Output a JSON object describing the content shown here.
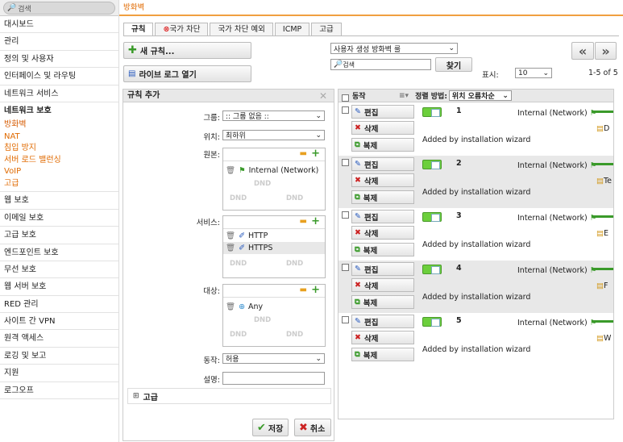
{
  "sidebar": {
    "search_placeholder": "검색",
    "items": [
      "대시보드",
      "관리",
      "정의 및 사용자",
      "인터페이스 및 라우팅",
      "네트워크 서비스"
    ],
    "section": "네트워크 보호",
    "subs": [
      "방화벽",
      "NAT",
      "침입 방지",
      "서버 로드 밸런싱",
      "VoIP",
      "고급"
    ],
    "items2": [
      "웹 보호",
      "이메일 보호",
      "고급 보호",
      "엔드포인트 보호",
      "무선 보호",
      "웹 서버 보호",
      "RED 관리",
      "사이트 간 VPN",
      "원격 액세스",
      "로깅 및 보고",
      "지원",
      "로그오프"
    ]
  },
  "page": {
    "title": "방화벽"
  },
  "tabs": [
    "규칙",
    "국가 차단",
    "국가 차단 예외",
    "ICMP",
    "고급"
  ],
  "toolbar": {
    "new_rule": "새 규칙...",
    "live_log": "라이브 로그 열기",
    "filter_select": "사용자 생성 방화벽 룰",
    "search_placeholder": "검색",
    "find": "찾기",
    "display_label": "표시:",
    "display_value": "10",
    "range": "1-5 of 5",
    "prev": "«",
    "next": "»"
  },
  "add_rule": {
    "title": "규칙 추가",
    "group_label": "그룹:",
    "group_value": ":: 그룹 없음 ::",
    "position_label": "위치:",
    "position_value": "최하위",
    "source_label": "원본:",
    "source_items": [
      "Internal (Network)"
    ],
    "service_label": "서비스:",
    "service_items": [
      "HTTP",
      "HTTPS"
    ],
    "dest_label": "대상:",
    "dest_items": [
      "Any"
    ],
    "action_label": "동작:",
    "action_value": "허용",
    "desc_label": "설명:",
    "advanced": "고급",
    "save": "저장",
    "cancel": "취소",
    "dnd": "DND"
  },
  "table": {
    "col_action": "동작",
    "sort_label": "정렬 방법:",
    "sort_value": "위치 오름차순",
    "edit": "편집",
    "delete": "삭제",
    "clone": "복제",
    "rows": [
      {
        "num": "1",
        "source": "Internal (Network)",
        "note": "Added by installation wizard",
        "dest": "D"
      },
      {
        "num": "2",
        "source": "Internal (Network)",
        "note": "Added by installation wizard",
        "dest": "Te"
      },
      {
        "num": "3",
        "source": "Internal (Network)",
        "note": "Added by installation wizard",
        "dest": "E"
      },
      {
        "num": "4",
        "source": "Internal (Network)",
        "note": "Added by installation wizard",
        "dest": "F"
      },
      {
        "num": "5",
        "source": "Internal (Network)",
        "note": "Added by installation wizard",
        "dest": "W"
      }
    ]
  },
  "colors": {
    "accent": "#e06a00",
    "toggle": "#6ccf3c",
    "delete": "#cc2222",
    "save": "#3a9a2a"
  }
}
